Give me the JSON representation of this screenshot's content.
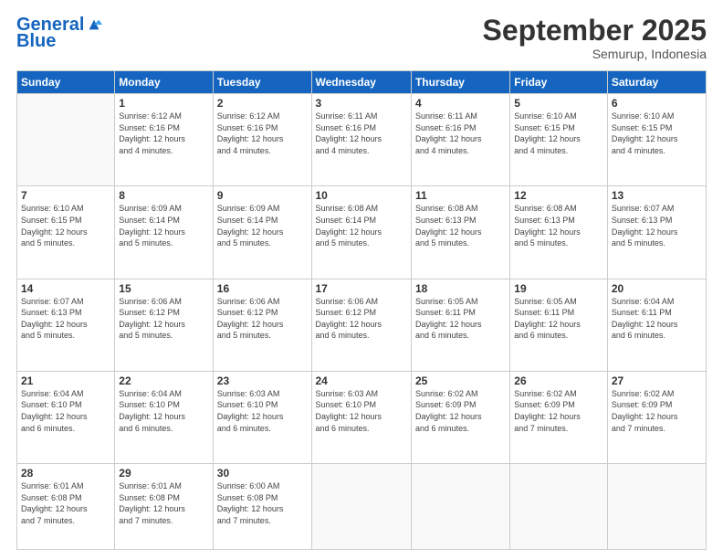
{
  "header": {
    "logo_line1": "General",
    "logo_line2": "Blue",
    "month": "September 2025",
    "location": "Semurup, Indonesia"
  },
  "days_of_week": [
    "Sunday",
    "Monday",
    "Tuesday",
    "Wednesday",
    "Thursday",
    "Friday",
    "Saturday"
  ],
  "weeks": [
    [
      {
        "day": "",
        "info": ""
      },
      {
        "day": "1",
        "info": "Sunrise: 6:12 AM\nSunset: 6:16 PM\nDaylight: 12 hours\nand 4 minutes."
      },
      {
        "day": "2",
        "info": "Sunrise: 6:12 AM\nSunset: 6:16 PM\nDaylight: 12 hours\nand 4 minutes."
      },
      {
        "day": "3",
        "info": "Sunrise: 6:11 AM\nSunset: 6:16 PM\nDaylight: 12 hours\nand 4 minutes."
      },
      {
        "day": "4",
        "info": "Sunrise: 6:11 AM\nSunset: 6:16 PM\nDaylight: 12 hours\nand 4 minutes."
      },
      {
        "day": "5",
        "info": "Sunrise: 6:10 AM\nSunset: 6:15 PM\nDaylight: 12 hours\nand 4 minutes."
      },
      {
        "day": "6",
        "info": "Sunrise: 6:10 AM\nSunset: 6:15 PM\nDaylight: 12 hours\nand 4 minutes."
      }
    ],
    [
      {
        "day": "7",
        "info": "Sunrise: 6:10 AM\nSunset: 6:15 PM\nDaylight: 12 hours\nand 5 minutes."
      },
      {
        "day": "8",
        "info": "Sunrise: 6:09 AM\nSunset: 6:14 PM\nDaylight: 12 hours\nand 5 minutes."
      },
      {
        "day": "9",
        "info": "Sunrise: 6:09 AM\nSunset: 6:14 PM\nDaylight: 12 hours\nand 5 minutes."
      },
      {
        "day": "10",
        "info": "Sunrise: 6:08 AM\nSunset: 6:14 PM\nDaylight: 12 hours\nand 5 minutes."
      },
      {
        "day": "11",
        "info": "Sunrise: 6:08 AM\nSunset: 6:13 PM\nDaylight: 12 hours\nand 5 minutes."
      },
      {
        "day": "12",
        "info": "Sunrise: 6:08 AM\nSunset: 6:13 PM\nDaylight: 12 hours\nand 5 minutes."
      },
      {
        "day": "13",
        "info": "Sunrise: 6:07 AM\nSunset: 6:13 PM\nDaylight: 12 hours\nand 5 minutes."
      }
    ],
    [
      {
        "day": "14",
        "info": "Sunrise: 6:07 AM\nSunset: 6:13 PM\nDaylight: 12 hours\nand 5 minutes."
      },
      {
        "day": "15",
        "info": "Sunrise: 6:06 AM\nSunset: 6:12 PM\nDaylight: 12 hours\nand 5 minutes."
      },
      {
        "day": "16",
        "info": "Sunrise: 6:06 AM\nSunset: 6:12 PM\nDaylight: 12 hours\nand 5 minutes."
      },
      {
        "day": "17",
        "info": "Sunrise: 6:06 AM\nSunset: 6:12 PM\nDaylight: 12 hours\nand 6 minutes."
      },
      {
        "day": "18",
        "info": "Sunrise: 6:05 AM\nSunset: 6:11 PM\nDaylight: 12 hours\nand 6 minutes."
      },
      {
        "day": "19",
        "info": "Sunrise: 6:05 AM\nSunset: 6:11 PM\nDaylight: 12 hours\nand 6 minutes."
      },
      {
        "day": "20",
        "info": "Sunrise: 6:04 AM\nSunset: 6:11 PM\nDaylight: 12 hours\nand 6 minutes."
      }
    ],
    [
      {
        "day": "21",
        "info": "Sunrise: 6:04 AM\nSunset: 6:10 PM\nDaylight: 12 hours\nand 6 minutes."
      },
      {
        "day": "22",
        "info": "Sunrise: 6:04 AM\nSunset: 6:10 PM\nDaylight: 12 hours\nand 6 minutes."
      },
      {
        "day": "23",
        "info": "Sunrise: 6:03 AM\nSunset: 6:10 PM\nDaylight: 12 hours\nand 6 minutes."
      },
      {
        "day": "24",
        "info": "Sunrise: 6:03 AM\nSunset: 6:10 PM\nDaylight: 12 hours\nand 6 minutes."
      },
      {
        "day": "25",
        "info": "Sunrise: 6:02 AM\nSunset: 6:09 PM\nDaylight: 12 hours\nand 6 minutes."
      },
      {
        "day": "26",
        "info": "Sunrise: 6:02 AM\nSunset: 6:09 PM\nDaylight: 12 hours\nand 7 minutes."
      },
      {
        "day": "27",
        "info": "Sunrise: 6:02 AM\nSunset: 6:09 PM\nDaylight: 12 hours\nand 7 minutes."
      }
    ],
    [
      {
        "day": "28",
        "info": "Sunrise: 6:01 AM\nSunset: 6:08 PM\nDaylight: 12 hours\nand 7 minutes."
      },
      {
        "day": "29",
        "info": "Sunrise: 6:01 AM\nSunset: 6:08 PM\nDaylight: 12 hours\nand 7 minutes."
      },
      {
        "day": "30",
        "info": "Sunrise: 6:00 AM\nSunset: 6:08 PM\nDaylight: 12 hours\nand 7 minutes."
      },
      {
        "day": "",
        "info": ""
      },
      {
        "day": "",
        "info": ""
      },
      {
        "day": "",
        "info": ""
      },
      {
        "day": "",
        "info": ""
      }
    ]
  ]
}
